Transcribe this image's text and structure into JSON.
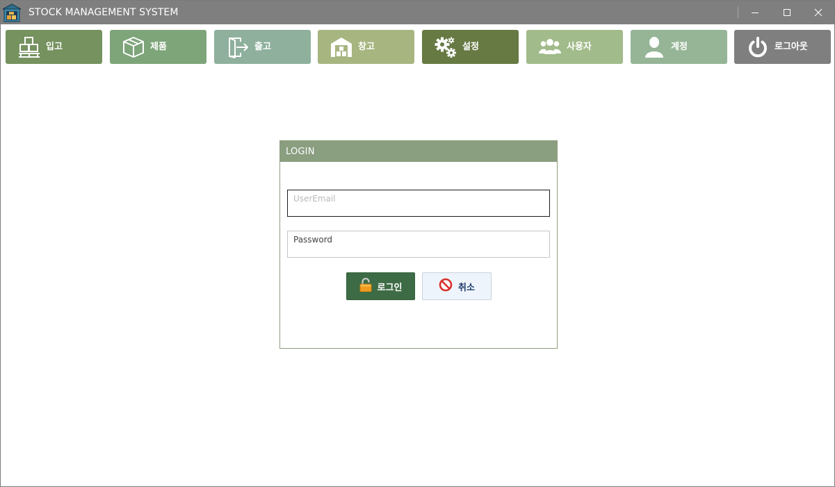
{
  "window": {
    "title": "STOCK MANAGEMENT SYSTEM",
    "minimize_icon": "minimize-icon",
    "maximize_icon": "maximize-icon",
    "close_icon": "close-icon"
  },
  "toolbar": {
    "items": [
      {
        "label": "입고",
        "icon": "inbound-pallet-icon",
        "color": "#75925f"
      },
      {
        "label": "제품",
        "icon": "product-box-icon",
        "color": "#7ea57a"
      },
      {
        "label": "출고",
        "icon": "outbound-door-icon",
        "color": "#8eb09c"
      },
      {
        "label": "창고",
        "icon": "warehouse-icon",
        "color": "#a7b581"
      },
      {
        "label": "설정",
        "icon": "gears-icon",
        "color": "#677a43"
      },
      {
        "label": "사용자",
        "icon": "users-icon",
        "color": "#a1bb8a"
      },
      {
        "label": "계정",
        "icon": "user-icon",
        "color": "#95b596"
      },
      {
        "label": "로그아웃",
        "icon": "power-icon",
        "color": "#7f7f7f"
      }
    ]
  },
  "login": {
    "header": "LOGIN",
    "email_placeholder": "UserEmail",
    "email_value": "",
    "password_placeholder": "Password",
    "password_value": "",
    "login_button": "로그인",
    "cancel_button": "취소",
    "colors": {
      "header": "#8a9e80",
      "login_button": "#3d6b45",
      "cancel_button": "#eef4fb"
    }
  }
}
